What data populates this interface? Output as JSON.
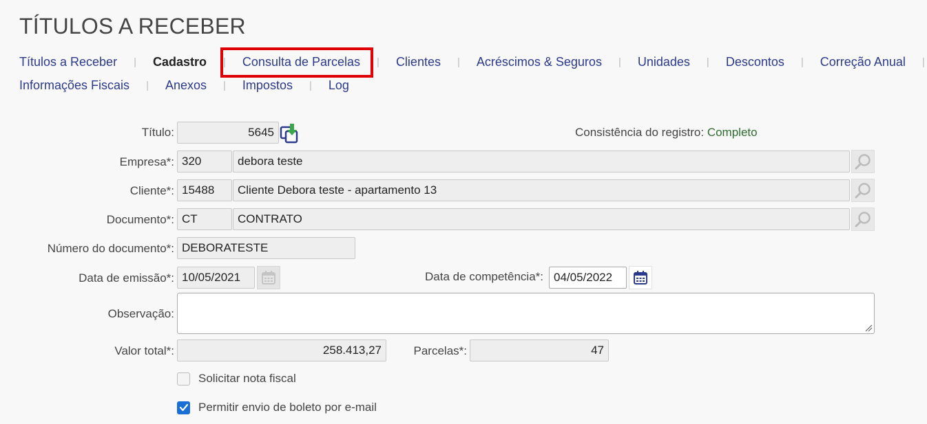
{
  "page": {
    "title": "TÍTULOS A RECEBER"
  },
  "tabs_row1": [
    {
      "label": "Títulos a Receber",
      "active": false
    },
    {
      "label": "Cadastro",
      "active": true
    },
    {
      "label": "Consulta de Parcelas",
      "active": false
    },
    {
      "label": "Clientes",
      "active": false
    },
    {
      "label": "Acréscimos & Seguros",
      "active": false
    },
    {
      "label": "Unidades",
      "active": false
    },
    {
      "label": "Descontos",
      "active": false
    },
    {
      "label": "Correção Anual",
      "active": false
    }
  ],
  "tabs_row2": [
    {
      "label": "Informações Fiscais",
      "active": false
    },
    {
      "label": "Anexos",
      "active": false
    },
    {
      "label": "Impostos",
      "active": false
    },
    {
      "label": "Log",
      "active": false
    }
  ],
  "separator": "|",
  "form": {
    "titulo": {
      "label": "Título:",
      "value": "5645"
    },
    "consistency": {
      "label": "Consistência do registro:",
      "value": "Completo"
    },
    "empresa": {
      "label": "Empresa*:",
      "code": "320",
      "name": "debora teste"
    },
    "cliente": {
      "label": "Cliente*:",
      "code": "15488",
      "name": "Cliente Debora teste - apartamento 13"
    },
    "documento": {
      "label": "Documento*:",
      "code": "CT",
      "name": "CONTRATO"
    },
    "numero_documento": {
      "label": "Número do documento*:",
      "value": "DEBORATESTE"
    },
    "data_emissao": {
      "label": "Data de emissão*:",
      "value": "10/05/2021"
    },
    "data_competencia": {
      "label": "Data de competência*:",
      "value": "04/05/2022"
    },
    "observacao": {
      "label": "Observação:",
      "value": ""
    },
    "valor_total": {
      "label": "Valor total*:",
      "value": "258.413,27"
    },
    "parcelas": {
      "label": "Parcelas*:",
      "value": "47"
    },
    "solicitar_nota": {
      "label": "Solicitar nota fiscal",
      "checked": false
    },
    "permitir_boleto": {
      "label": "Permitir envio de boleto por e-mail",
      "checked": true
    }
  },
  "icons": {
    "copy": "copy-download-icon",
    "lookup": "magnifier-icon",
    "calendar": "calendar-icon"
  },
  "colors": {
    "link": "#2b3a8c",
    "highlight": "#e00000",
    "ok": "#2e6b2e",
    "checkbox_checked": "#1a6fd6"
  }
}
